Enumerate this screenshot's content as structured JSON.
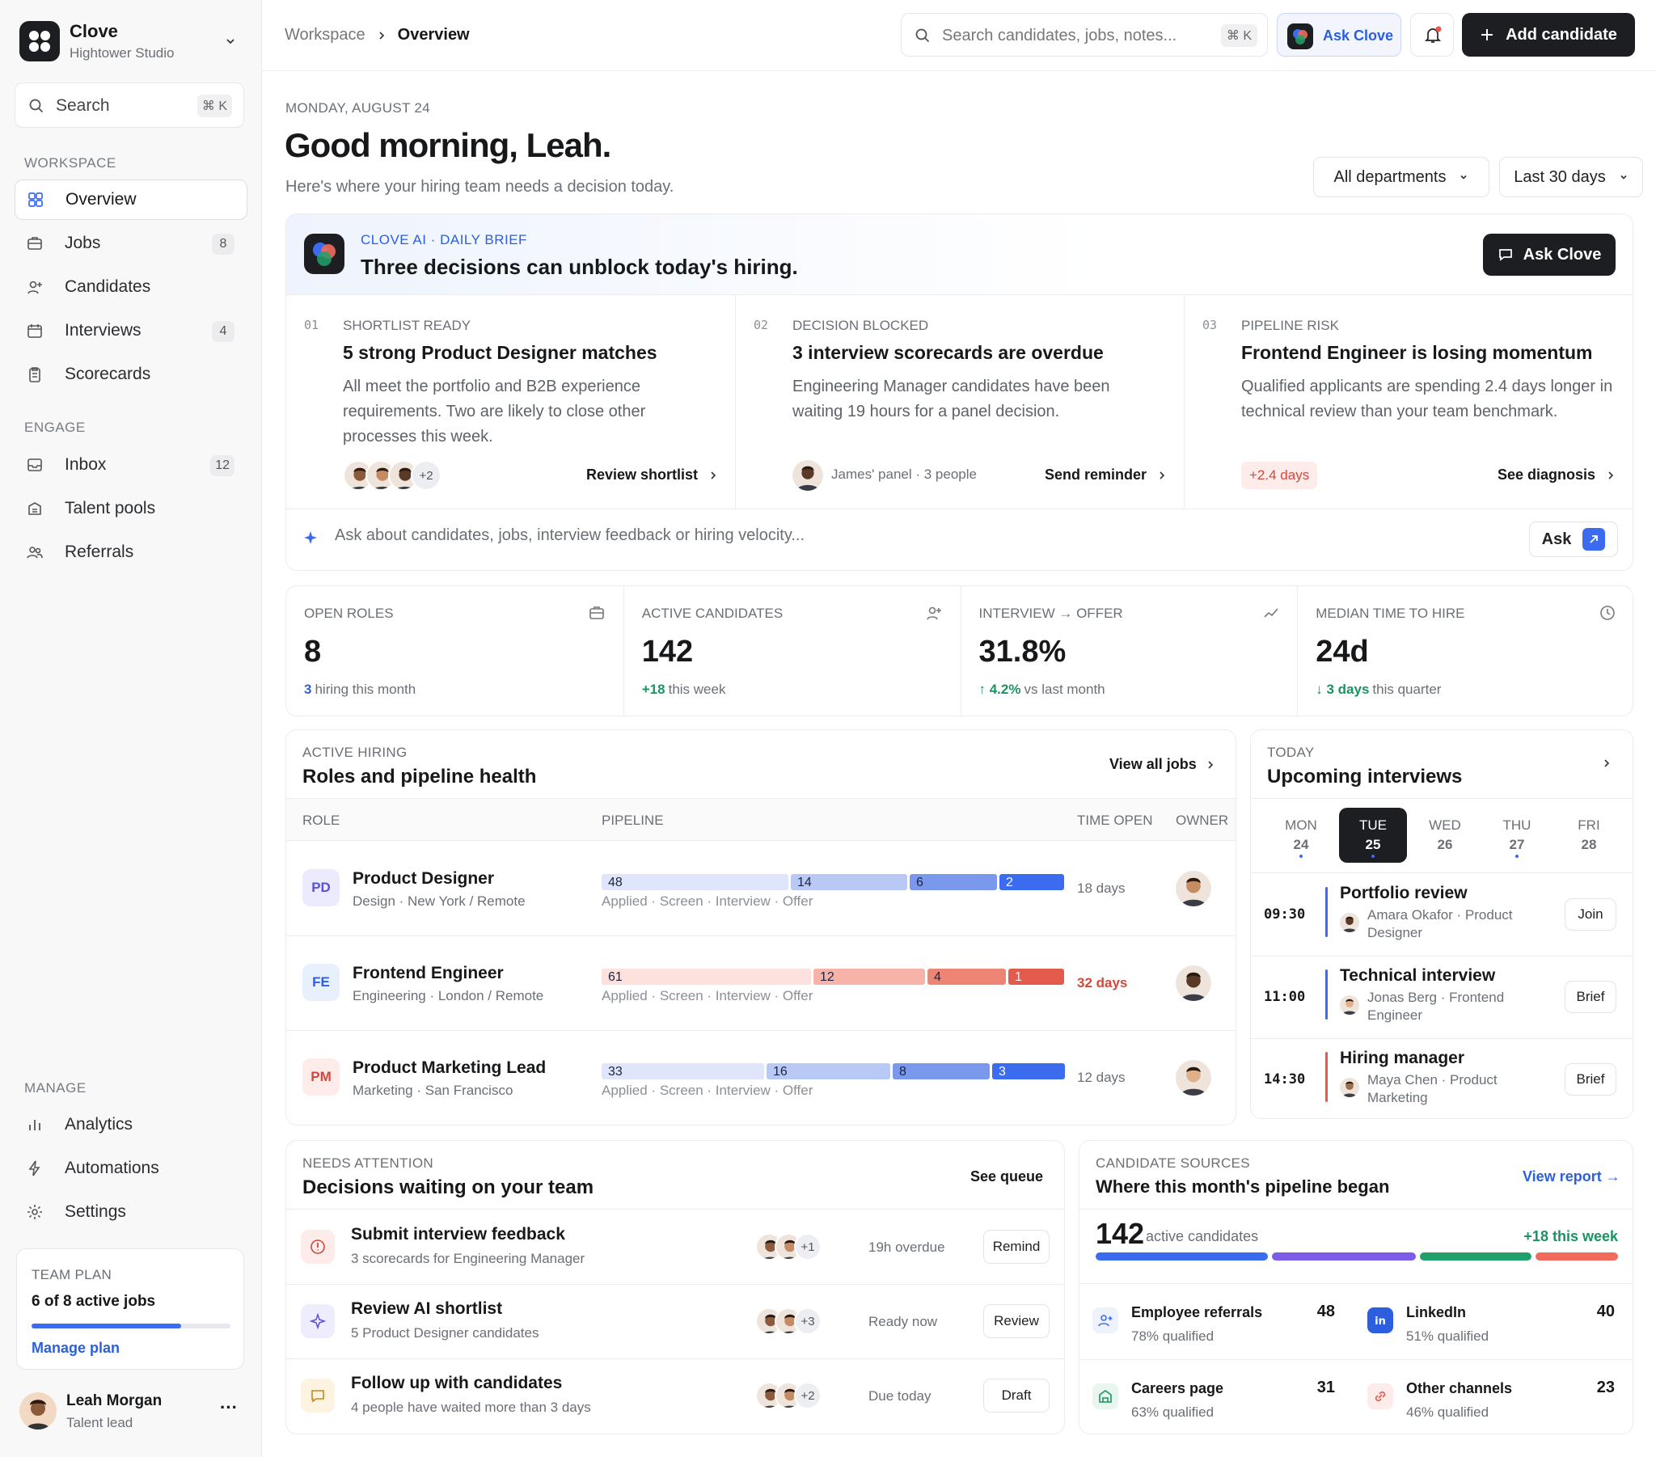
{
  "brand": {
    "name": "Clove",
    "workspace": "Hightower Studio"
  },
  "sidebar": {
    "search": {
      "label": "Search",
      "shortcut": "⌘ K"
    },
    "workspace_label": "WORKSPACE",
    "workspace_items": [
      {
        "label": "Overview",
        "icon": "grid-icon",
        "active": true
      },
      {
        "label": "Jobs",
        "icon": "briefcase-icon",
        "count": "8"
      },
      {
        "label": "Candidates",
        "icon": "user-plus-icon"
      },
      {
        "label": "Interviews",
        "icon": "calendar-icon",
        "count": "4"
      },
      {
        "label": "Scorecards",
        "icon": "clipboard-icon"
      }
    ],
    "engage_label": "ENGAGE",
    "engage_items": [
      {
        "label": "Inbox",
        "icon": "inbox-icon",
        "count": "12"
      },
      {
        "label": "Talent pools",
        "icon": "pool-icon"
      },
      {
        "label": "Referrals",
        "icon": "users-icon"
      }
    ],
    "manage_label": "MANAGE",
    "manage_items": [
      {
        "label": "Analytics",
        "icon": "bar-chart-icon"
      },
      {
        "label": "Automations",
        "icon": "bolt-icon"
      },
      {
        "label": "Settings",
        "icon": "gear-icon"
      }
    ],
    "plan": {
      "label": "TEAM PLAN",
      "usage": "6 of 8 active jobs",
      "progress": 0.75,
      "link": "Manage plan"
    },
    "user": {
      "name": "Leah Morgan",
      "role": "Talent lead",
      "more": "···"
    }
  },
  "topbar": {
    "breadcrumb": [
      "Workspace",
      "Overview"
    ],
    "search_placeholder": "Search candidates, jobs, notes...",
    "search_shortcut": "⌘ K",
    "ask_label": "Ask Clove",
    "add_label": "Add candidate"
  },
  "greeting": {
    "date": "MONDAY, AUGUST 24",
    "title": "Good morning, Leah.",
    "subtitle": "Here's where your hiring team needs a decision today.",
    "filters": [
      "All departments",
      "Last 30 days"
    ]
  },
  "brief": {
    "eyebrow": "CLOVE AI · DAILY BRIEF",
    "title": "Three decisions can unblock today's hiring.",
    "button": "Ask Clove",
    "items": [
      {
        "num": "01",
        "tag": "SHORTLIST READY",
        "title": "5 strong Product Designer matches",
        "body": "All meet the portfolio and B2B experience requirements. Two are likely to close other processes this week.",
        "meta": "+2",
        "action": "Review shortlist"
      },
      {
        "num": "02",
        "tag": "DECISION BLOCKED",
        "title": "3 interview scorecards are overdue",
        "body": "Engineering Manager candidates have been waiting 19 hours for a panel decision.",
        "meta": "James' panel · 3 people",
        "action": "Send reminder"
      },
      {
        "num": "03",
        "tag": "PIPELINE RISK",
        "title": "Frontend Engineer is losing momentum",
        "body": "Qualified applicants are spending 2.4 days longer in technical review than your team benchmark.",
        "meta": "+2.4 days",
        "action": "See diagnosis"
      }
    ],
    "ask_placeholder": "Ask about candidates, jobs, interview feedback or hiring velocity...",
    "ask_button": "Ask"
  },
  "stats": [
    {
      "label": "OPEN ROLES",
      "value": "8",
      "delta": "3",
      "delta_text": "hiring this month",
      "icon": "briefcase-icon"
    },
    {
      "label": "ACTIVE CANDIDATES",
      "value": "142",
      "delta": "+18",
      "delta_text": "this week",
      "icon": "user-plus-icon"
    },
    {
      "label": "INTERVIEW → OFFER",
      "value": "31.8%",
      "delta": "↑ 4.2%",
      "delta_text": "vs last month",
      "icon": "trend-icon"
    },
    {
      "label": "MEDIAN TIME TO HIRE",
      "value": "24d",
      "delta": "↓ 3 days",
      "delta_text": "this quarter",
      "icon": "clock-icon"
    }
  ],
  "hiring": {
    "eyebrow": "ACTIVE HIRING",
    "title": "Roles and pipeline health",
    "link": "View all jobs",
    "columns": [
      "ROLE",
      "PIPELINE",
      "TIME OPEN",
      "OWNER"
    ],
    "stages": "Applied · Screen · Interview · Offer",
    "rows": [
      {
        "code": "PD",
        "role": "Product Designer",
        "meta": "Design · New York / Remote",
        "pipeline": [
          48,
          14,
          6,
          2
        ],
        "time": "18 days",
        "warn": false,
        "palette": "blue"
      },
      {
        "code": "FE",
        "role": "Frontend Engineer",
        "meta": "Engineering · London / Remote",
        "pipeline": [
          61,
          12,
          4,
          1
        ],
        "time": "32 days",
        "warn": true,
        "palette": "red"
      },
      {
        "code": "PM",
        "role": "Product Marketing Lead",
        "meta": "Marketing · San Francisco",
        "pipeline": [
          33,
          16,
          8,
          3
        ],
        "time": "12 days",
        "warn": false,
        "palette": "blue"
      }
    ]
  },
  "interviews": {
    "eyebrow": "TODAY",
    "title": "Upcoming interviews",
    "days": [
      {
        "d": "MON",
        "n": "24",
        "dot": true
      },
      {
        "d": "TUE",
        "n": "25",
        "dot": true,
        "active": true
      },
      {
        "d": "WED",
        "n": "26",
        "dot": false
      },
      {
        "d": "THU",
        "n": "27",
        "dot": true
      },
      {
        "d": "FRI",
        "n": "28",
        "dot": false
      }
    ],
    "items": [
      {
        "time": "09:30",
        "title": "Portfolio review",
        "who": "Amara Okafor · Product Designer",
        "action": "Join",
        "color": "#3b6cf0"
      },
      {
        "time": "11:00",
        "title": "Technical interview",
        "who": "Jonas Berg · Frontend Engineer",
        "action": "Brief",
        "color": "#3b6cf0"
      },
      {
        "time": "14:30",
        "title": "Hiring manager",
        "who": "Maya Chen · Product Marketing",
        "action": "Brief",
        "color": "#e25b4d"
      }
    ]
  },
  "attention": {
    "eyebrow": "NEEDS ATTENTION",
    "title": "Decisions waiting on your team",
    "link": "See queue",
    "items": [
      {
        "title": "Submit interview feedback",
        "sub": "3 scorecards for Engineering Manager",
        "more": "+1",
        "status": "19h overdue",
        "action": "Remind",
        "icon": "alert-icon"
      },
      {
        "title": "Review AI shortlist",
        "sub": "5 Product Designer candidates",
        "more": "+3",
        "status": "Ready now",
        "action": "Review",
        "icon": "sparkle-icon"
      },
      {
        "title": "Follow up with candidates",
        "sub": "4 people have waited more than 3 days",
        "more": "+2",
        "status": "Due today",
        "action": "Draft",
        "icon": "message-icon"
      }
    ]
  },
  "sources": {
    "eyebrow": "CANDIDATE SOURCES",
    "title": "Where this month's pipeline began",
    "link": "View report →",
    "total": "142",
    "total_label": "active candidates",
    "delta": "+18 this week",
    "segments": [
      {
        "value": 48,
        "color": "#3b6cf0"
      },
      {
        "value": 40,
        "color": "#7c5ce8"
      },
      {
        "value": 31,
        "color": "#22a06b"
      },
      {
        "value": 23,
        "color": "#f06b5b"
      }
    ],
    "items": [
      {
        "name": "Employee referrals",
        "sub": "78% qualified",
        "value": "48",
        "icon": "referral-icon"
      },
      {
        "name": "LinkedIn",
        "sub": "51% qualified",
        "value": "40",
        "icon": "linkedin-icon"
      },
      {
        "name": "Careers page",
        "sub": "63% qualified",
        "value": "31",
        "icon": "building-icon"
      },
      {
        "name": "Other channels",
        "sub": "46% qualified",
        "value": "23",
        "icon": "link-icon"
      }
    ]
  }
}
